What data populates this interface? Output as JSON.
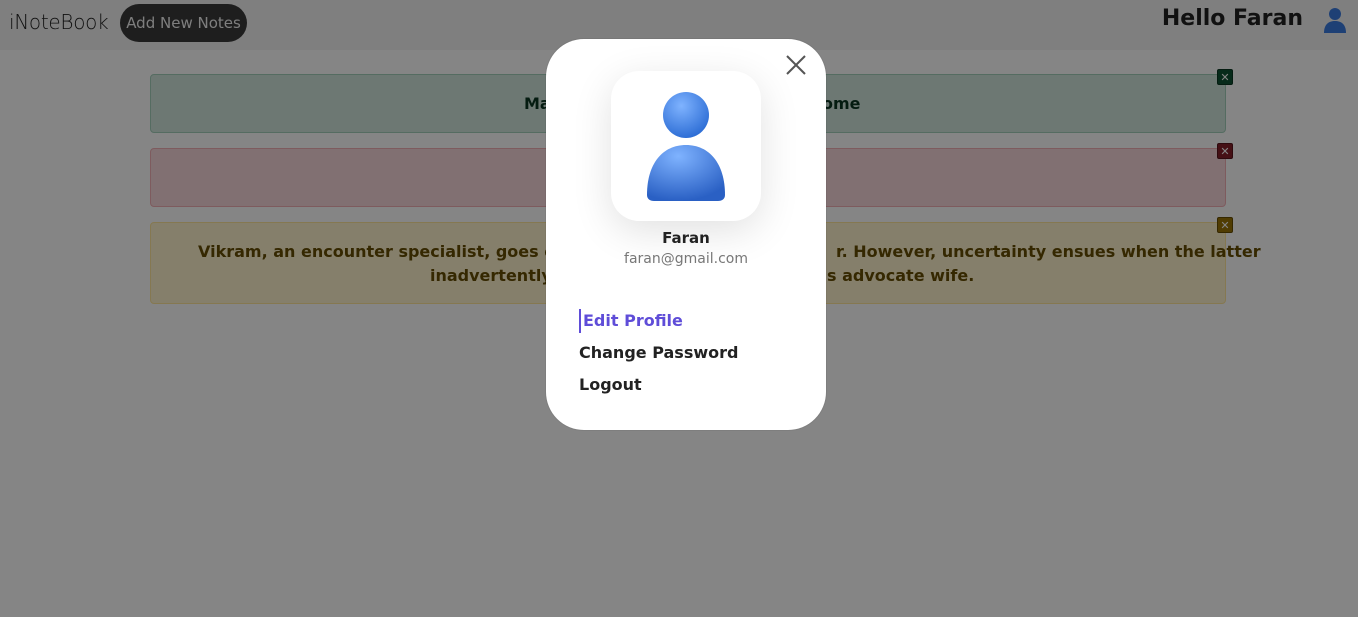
{
  "navbar": {
    "brand": "iNoteBook",
    "add_button_label": "Add New Notes",
    "greeting": "Hello Faran",
    "avatar_icon": "user-avatar-icon"
  },
  "notes": [
    {
      "text": "Ma",
      "text_right": "ome",
      "color": "green",
      "close_icon": "close-icon"
    },
    {
      "text": "",
      "color": "red",
      "close_icon": "close-icon"
    },
    {
      "text": "Vikram, an encounter specialist, goes on the l",
      "text_right": "r. However, uncertainty ensues when the latter",
      "text_line2_left": "inadvertently s",
      "text_line2_right": "s advocate wife.",
      "color": "yellow",
      "close_icon": "close-icon"
    }
  ],
  "modal": {
    "close_icon": "close-x-icon",
    "profile_name": "Faran",
    "profile_email": "faran@gmail.com",
    "menu": [
      {
        "label": "Edit Profile",
        "active": true
      },
      {
        "label": "Change Password",
        "active": false
      },
      {
        "label": "Logout",
        "active": false
      }
    ]
  },
  "colors": {
    "accent": "#5f4dd8",
    "avatar_blue": "#3b7be0",
    "overlay": "rgba(0,0,0,0.48)"
  }
}
